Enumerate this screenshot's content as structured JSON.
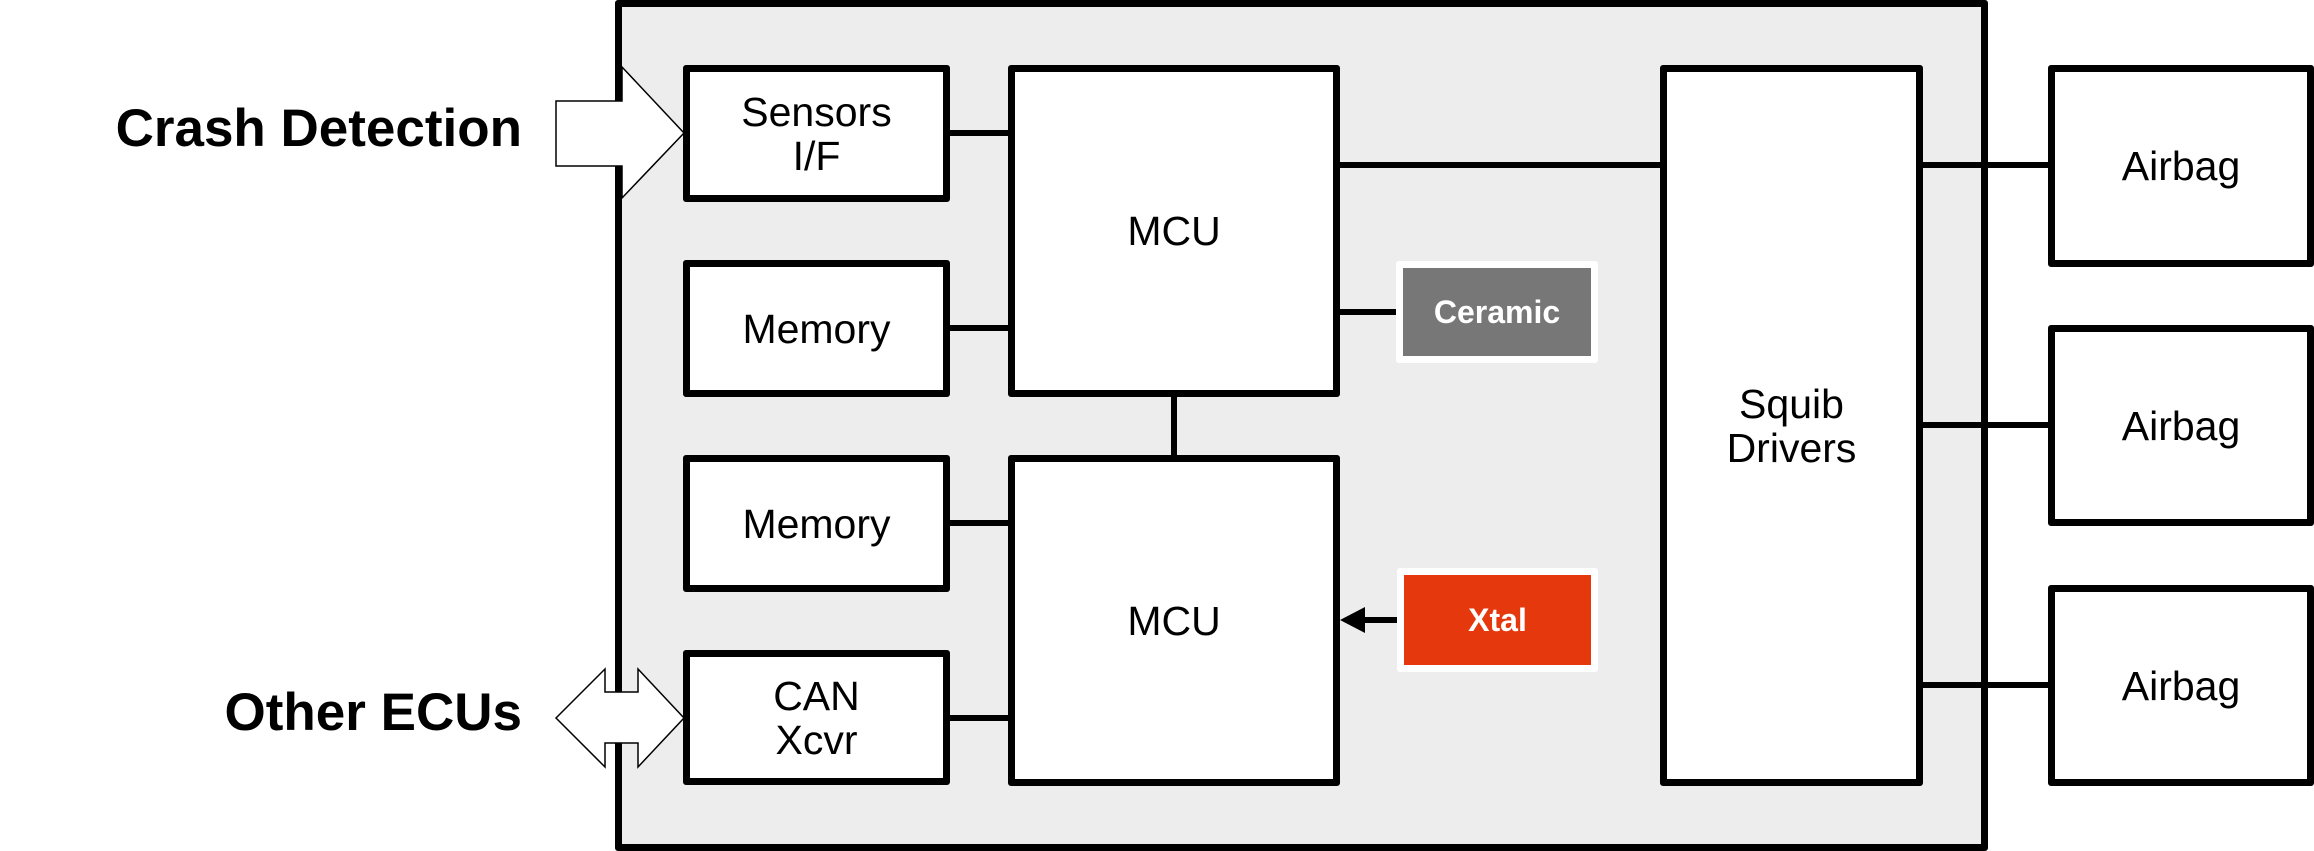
{
  "labels": {
    "crash_detection": "Crash Detection",
    "other_ecus": "Other ECUs"
  },
  "blocks": {
    "sensors_if": "Sensors\nI/F",
    "memory_1": "Memory",
    "memory_2": "Memory",
    "can_xcvr": "CAN\nXcvr",
    "mcu_1": "MCU",
    "mcu_2": "MCU",
    "squib_drivers": "Squib\nDrivers",
    "airbag_1": "Airbag",
    "airbag_2": "Airbag",
    "airbag_3": "Airbag"
  },
  "clocks": {
    "ceramic": {
      "label": "Ceramic",
      "color": "#777777"
    },
    "xtal": {
      "label": "Xtal",
      "color": "#e5380d"
    }
  },
  "colors": {
    "ecu_background": "#ededed",
    "line": "#000000"
  }
}
